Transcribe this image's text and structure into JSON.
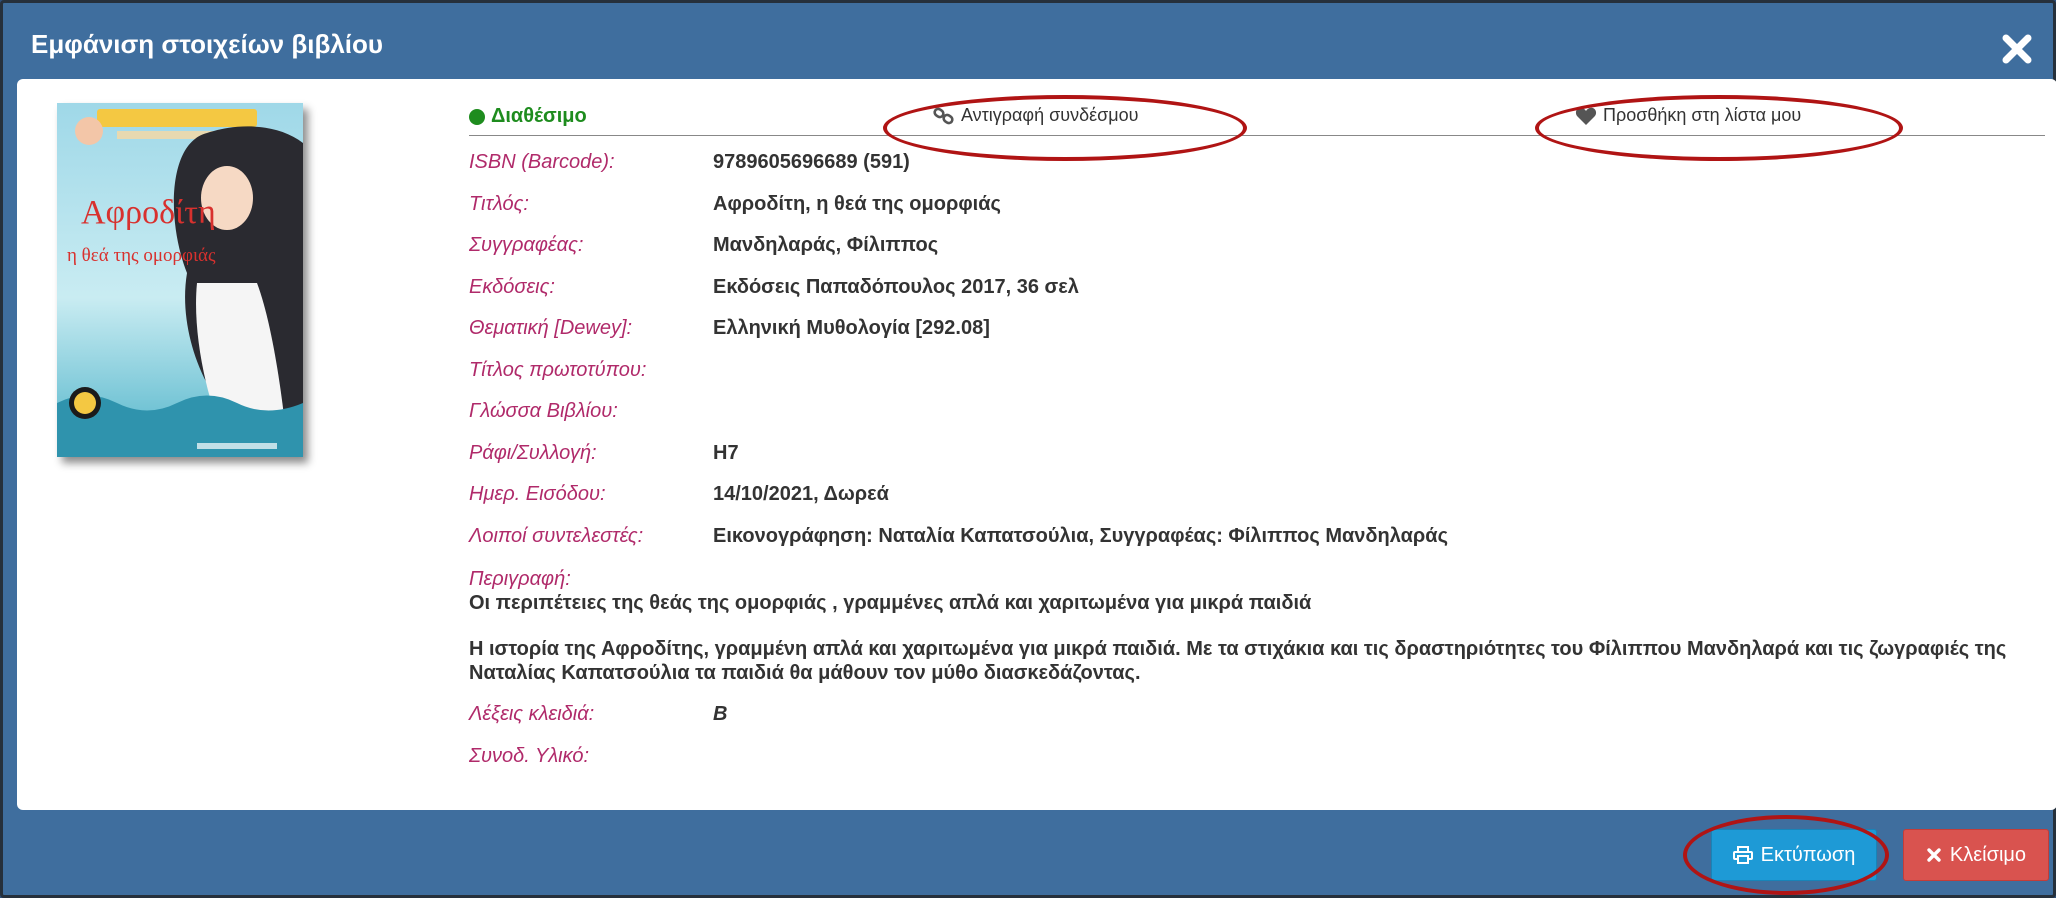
{
  "dialog": {
    "title": "Εμφάνιση στοιχείων βιβλίου"
  },
  "book": {
    "cover_title_line1": "Αφροδίτη",
    "cover_title_line2": "η θεά της ομορφιάς",
    "status": "Διαθέσιμο",
    "copy_link_label": "Αντιγραφή συνδέσμου",
    "add_to_list_label": "Προσθήκη στη λίστα μου",
    "fields": [
      {
        "label": "ISBN (Barcode):",
        "value": "9789605696689 (591)"
      },
      {
        "label": "Τιτλός:",
        "value": "Αφροδίτη, η θεά της ομορφιάς"
      },
      {
        "label": "Συγγραφέας:",
        "value": "Μανδηλαράς, Φίλιππος"
      },
      {
        "label": "Εκδόσεις:",
        "value": "Εκδόσεις Παπαδόπουλος 2017, 36 σελ"
      },
      {
        "label": "Θεματική [Dewey]:",
        "value": "Ελληνική Μυθολογία [292.08]"
      },
      {
        "label": "Τίτλος πρωτοτύπου:",
        "value": ""
      },
      {
        "label": "Γλώσσα Βιβλίου:",
        "value": ""
      },
      {
        "label": "Ράφι/Συλλογή:",
        "value": "Η7"
      },
      {
        "label": "Ημερ. Εισόδου:",
        "value": "14/10/2021, Δωρεά"
      },
      {
        "label": "Λοιποί συντελεστές:",
        "value": "Εικονογράφηση: Ναταλία Καπατσούλια, Συγγραφέας: Φίλιππος Μανδηλαράς"
      }
    ],
    "description_label": "Περιγραφή:",
    "description_p1": "Οι περιπέτειες της θεάς της ομορφιάς , γραμμένες απλά και χαριτωμένα για μικρά παιδιά",
    "description_p2": "Η ιστορία της Αφροδίτης, γραμμένη απλά και χαριτωμένα για μικρά παιδιά. Με τα στιχάκια και τις δραστηριότητες του Φίλιππου Μανδηλαρά και τις ζωγραφιές της Ναταλίας Καπατσούλια τα παιδιά θα μάθουν τον μύθο διασκεδάζοντας.",
    "after_fields": [
      {
        "label": "Λέξεις κλειδιά:",
        "value": "Β"
      },
      {
        "label": "Συνοδ. Υλικό:",
        "value": ""
      }
    ]
  },
  "footer": {
    "print_label": "Εκτύπωση",
    "close_label": "Κλείσιμο"
  },
  "colors": {
    "header_bg": "#3f6e9e",
    "label": "#b02a6a",
    "status": "#1e8c1e",
    "print_btn": "#1e9ad6",
    "close_btn": "#d9534f",
    "annotation_ring": "#b01414"
  }
}
